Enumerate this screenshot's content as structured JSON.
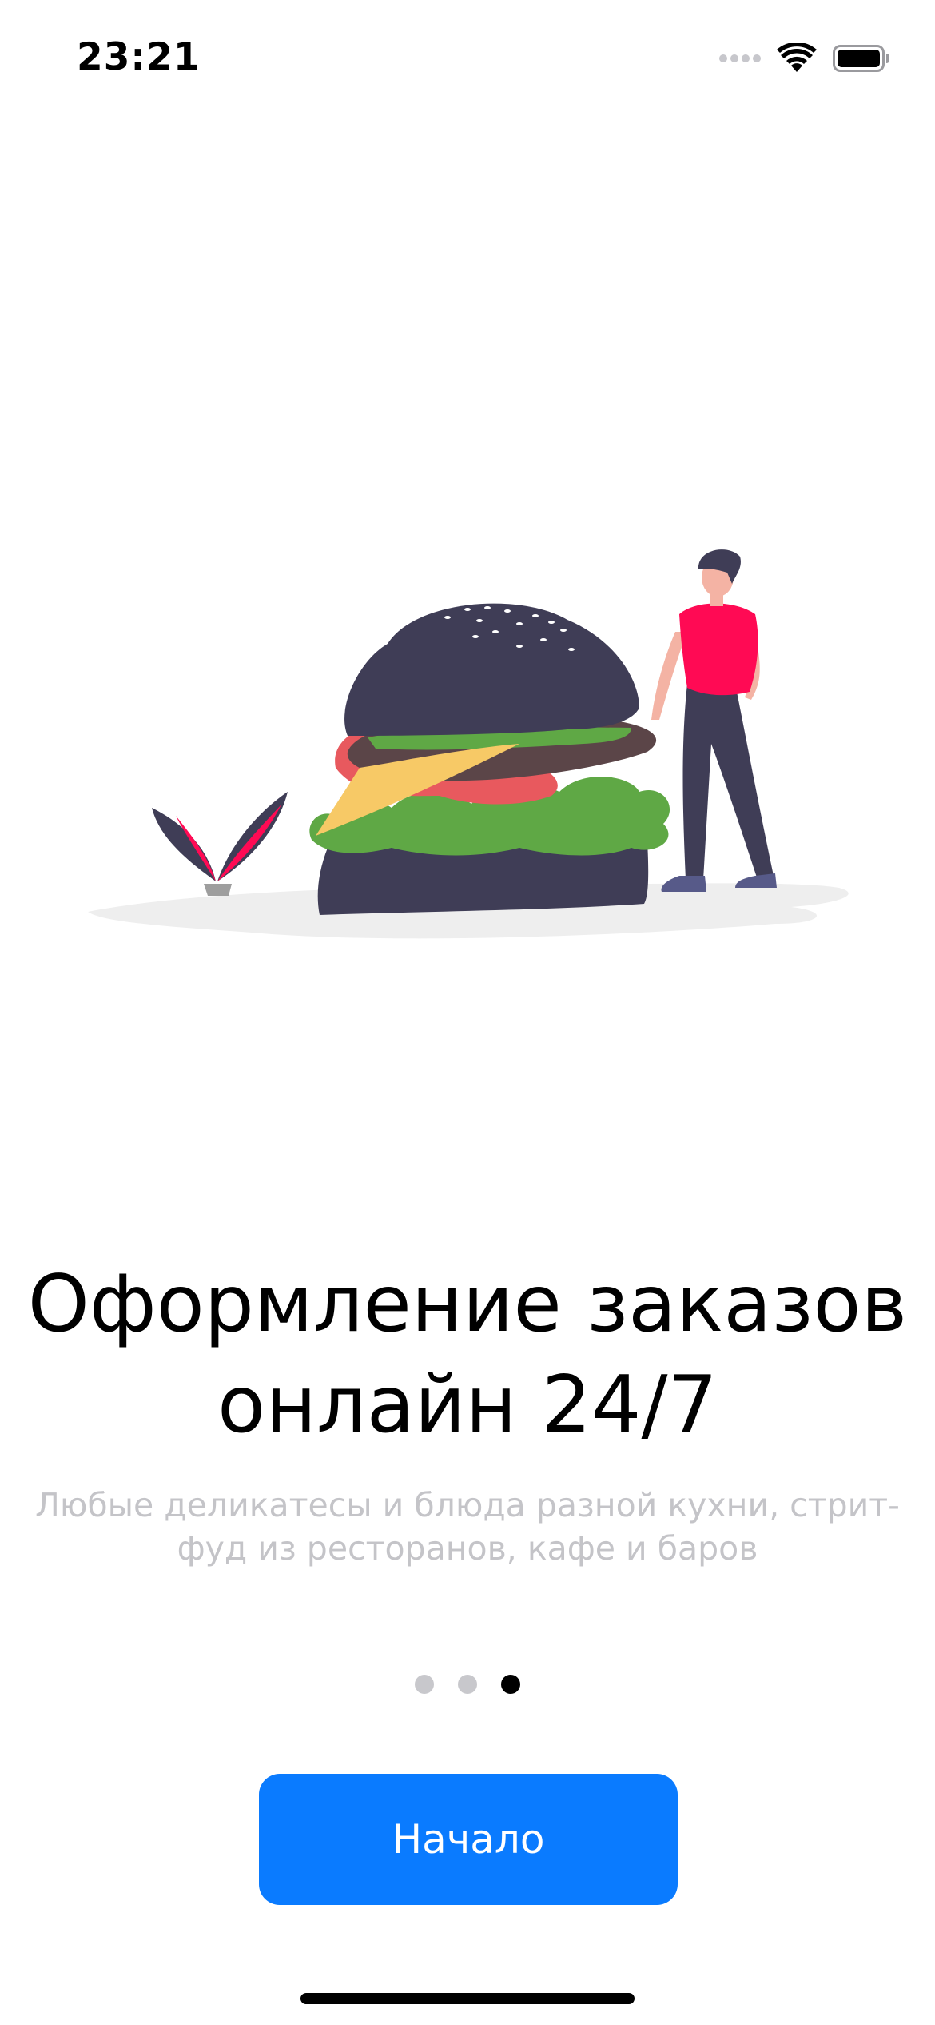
{
  "status_bar": {
    "time": "23:21",
    "icons": [
      "signal-dots-icon",
      "wifi-icon",
      "battery-icon"
    ]
  },
  "onboarding": {
    "illustration": "burger-and-person-illustration",
    "title": "Оформление заказов\nонлайн 24/7",
    "subtitle": "Любые деликатесы и блюда разной кухни, стрит-\nфуд из ресторанов, кафе и баров",
    "page_count": 3,
    "current_page": 3
  },
  "start_button": {
    "label": "Начало",
    "color": "#0a7bff"
  },
  "colors": {
    "accent": "#0a7bff",
    "subtitle": "#c4c4c8",
    "bun": "#3f3d56",
    "shirt": "#ff0a54",
    "lettuce": "#5fa845",
    "cheese": "#f7c966",
    "tomato": "#e8595e"
  }
}
